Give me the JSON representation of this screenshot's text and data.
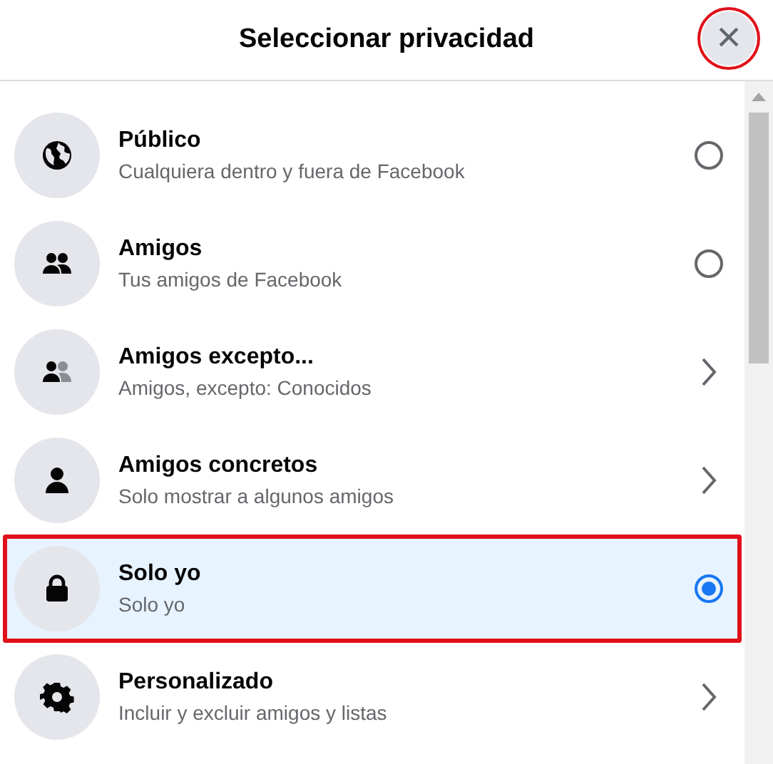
{
  "dialog": {
    "title": "Seleccionar privacidad",
    "close": {
      "label": "×",
      "marked": true
    }
  },
  "options": [
    {
      "title": "Público",
      "subtitle": "Cualquiera dentro y fuera de Facebook",
      "kind": "radio",
      "selected": false,
      "marked": false
    },
    {
      "title": "Amigos",
      "subtitle": "Tus amigos de Facebook",
      "kind": "radio",
      "selected": false,
      "marked": false
    },
    {
      "title": "Amigos excepto...",
      "subtitle": "Amigos, excepto: Conocidos",
      "kind": "chevron",
      "selected": false,
      "marked": false
    },
    {
      "title": "Amigos concretos",
      "subtitle": "Solo mostrar a algunos amigos",
      "kind": "chevron",
      "selected": false,
      "marked": false
    },
    {
      "title": "Solo yo",
      "subtitle": "Solo yo",
      "kind": "radio",
      "selected": true,
      "marked": true
    },
    {
      "title": "Personalizado",
      "subtitle": "Incluir y excluir amigos y listas",
      "kind": "chevron",
      "selected": false,
      "marked": false
    }
  ]
}
